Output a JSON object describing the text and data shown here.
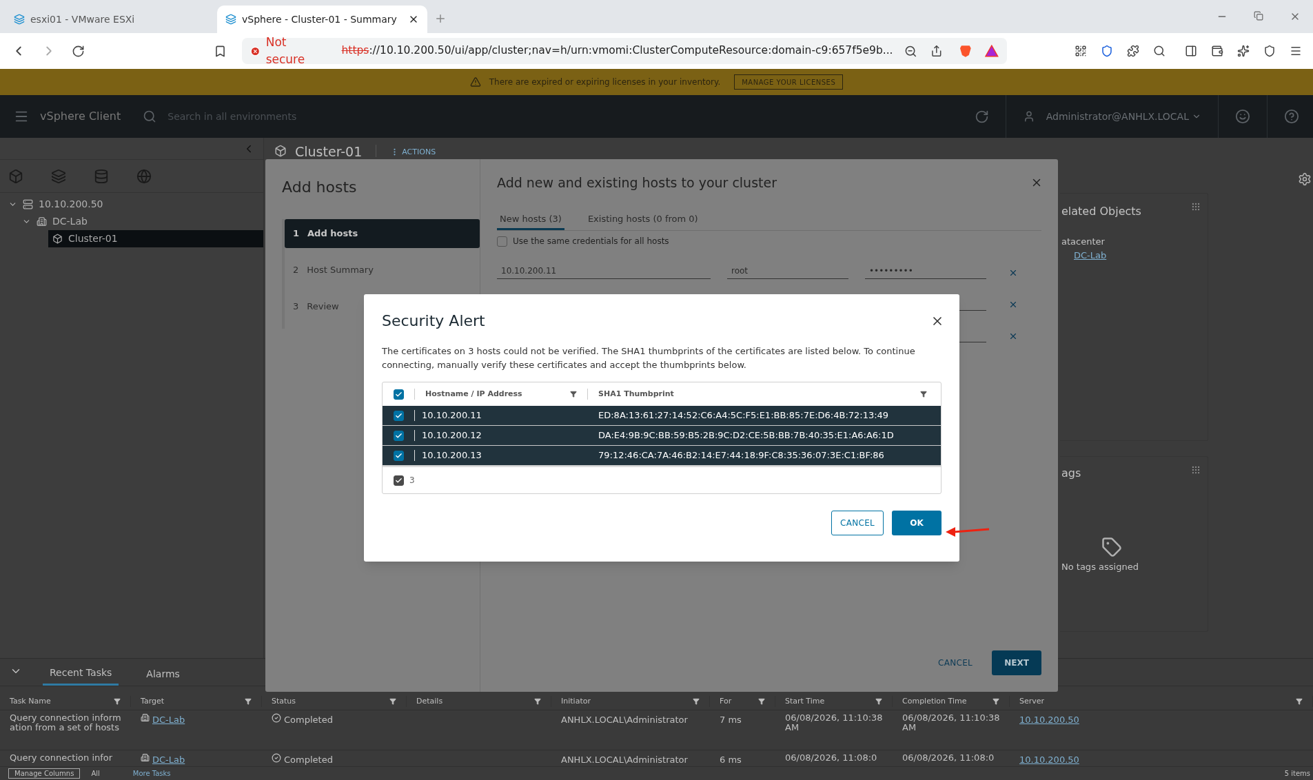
{
  "browser": {
    "tabs": [
      {
        "title": "esxi01 - VMware ESXi",
        "selected": false
      },
      {
        "title": "vSphere - Cluster-01 - Summary",
        "selected": true
      }
    ],
    "address": {
      "security": "Not secure",
      "scheme": "https",
      "rest": "://10.10.200.50/ui/app/cluster;nav=h/urn:vmomi:ClusterComputeResource:domain-c9:657f5e9b..."
    }
  },
  "banner": {
    "message": "There are expired or expiring licenses in your inventory.",
    "button": "MANAGE YOUR LICENSES"
  },
  "header": {
    "app_name": "vSphere Client",
    "search_placeholder": "Search in all environments",
    "user": "Administrator@ANHLX.LOCAL"
  },
  "navigator": {
    "tree": [
      {
        "label": "10.10.200.50",
        "kind": "vcenter",
        "selected": false,
        "children": [
          {
            "label": "DC-Lab",
            "kind": "datacenter",
            "selected": false,
            "children": [
              {
                "label": "Cluster-01",
                "kind": "cluster",
                "selected": true
              }
            ]
          }
        ]
      }
    ]
  },
  "object": {
    "title": "Cluster-01",
    "actions": "ACTIONS"
  },
  "cards": {
    "related_title": "elated Objects",
    "related_label": "atacenter",
    "related_link": "DC-Lab",
    "tags_title": "ags",
    "tags_empty": "No tags assigned"
  },
  "wizard": {
    "title": "Add hosts",
    "steps": [
      {
        "number": "1",
        "label": "Add hosts",
        "selected": true
      },
      {
        "number": "2",
        "label": "Host Summary",
        "selected": false
      },
      {
        "number": "3",
        "label": "Review",
        "selected": false
      }
    ],
    "heading": "Add new and existing hosts to your cluster",
    "tabs": [
      {
        "label": "New hosts (3)",
        "selected": true
      },
      {
        "label": "Existing hosts (0 from 0)",
        "selected": false
      }
    ],
    "same_credentials": {
      "label": "Use the same credentials for all hosts",
      "checked": false
    },
    "host_rows": [
      {
        "host": "10.10.200.11",
        "user": "root",
        "password": "•••••••••"
      },
      {
        "covered": true
      },
      {
        "covered": true
      }
    ],
    "buttons": {
      "cancel": "CANCEL",
      "next": "NEXT"
    }
  },
  "alert": {
    "title": "Security Alert",
    "message": "The certificates on 3 hosts could not be verified. The SHA1 thumbprints of the certificates are listed below. To continue connecting, manually verify these certificates and accept the thumbprints below.",
    "select_all": true,
    "columns": [
      "Hostname / IP Address",
      "SHA1 Thumbprint"
    ],
    "rows": [
      {
        "host": "10.10.200.11",
        "thumbprint": "ED:8A:13:61:27:14:52:C6:A4:5C:F5:E1:BB:85:7E:D6:4B:72:13:49",
        "checked": true
      },
      {
        "host": "10.10.200.12",
        "thumbprint": "DA:E4:9B:9C:BB:59:B5:2B:9C:D2:CE:5B:BB:7B:40:35:E1:A6:A6:1D",
        "checked": true
      },
      {
        "host": "10.10.200.13",
        "thumbprint": "79:12:46:CA:7A:46:B2:14:E7:44:18:9F:C8:35:36:07:3E:C1:BF:86",
        "checked": true
      }
    ],
    "footer": {
      "count": "3",
      "checked": true
    },
    "buttons": {
      "cancel": "CANCEL",
      "ok": "OK"
    }
  },
  "tasks": {
    "tabs": [
      {
        "label": "Recent Tasks",
        "selected": true
      },
      {
        "label": "Alarms",
        "selected": false
      }
    ],
    "columns": [
      "Task Name",
      "Target",
      "Status",
      "Details",
      "Initiator",
      "For",
      "Start Time",
      "Completion Time",
      "Server"
    ],
    "rows": [
      {
        "task": "Query connection information from a set of hosts",
        "target": "DC-Lab",
        "status": "Completed",
        "initiator": "ANHLX.LOCAL\\Administrator",
        "queued": "7 ms",
        "start": "06/08/2026, 11:10:38 AM",
        "completion": "06/08/2026, 11:10:38 AM",
        "server": "10.10.200.50"
      },
      {
        "task": "Query connection infor",
        "target": "DC-Lab",
        "status": "Completed",
        "initiator": "ANHLX.LOCAL\\Administrator",
        "queued": "6 ms",
        "start": "06/08/2026, 11:08:0",
        "completion": "06/08/2026, 11:08:0",
        "server": "10.10.200.50"
      }
    ],
    "footer": {
      "manage": "Manage Columns",
      "filter": "All",
      "more": "More Tasks",
      "count": "5 items"
    }
  }
}
